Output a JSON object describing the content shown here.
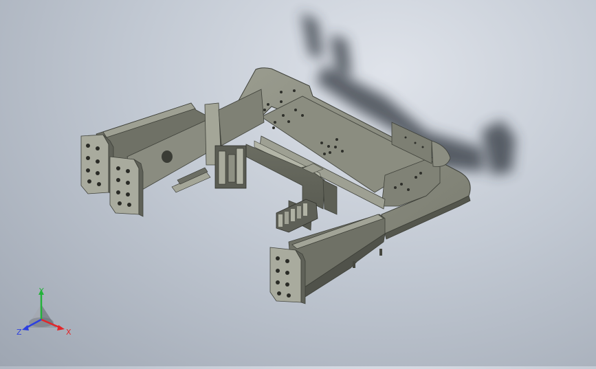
{
  "viewport": {
    "background_top": "#dfe3ea",
    "background_bottom": "#9ea6b2",
    "model_body_color": "#7b7d72",
    "model_top_color": "#8f9185",
    "model_dark_color": "#4e5048",
    "shadow_color": "#2c3038"
  },
  "triad": {
    "x_label": "X",
    "y_label": "Y",
    "z_label": "Z",
    "x_color": "#e3262a",
    "y_color": "#23b23a",
    "z_color": "#2c3fe0"
  }
}
